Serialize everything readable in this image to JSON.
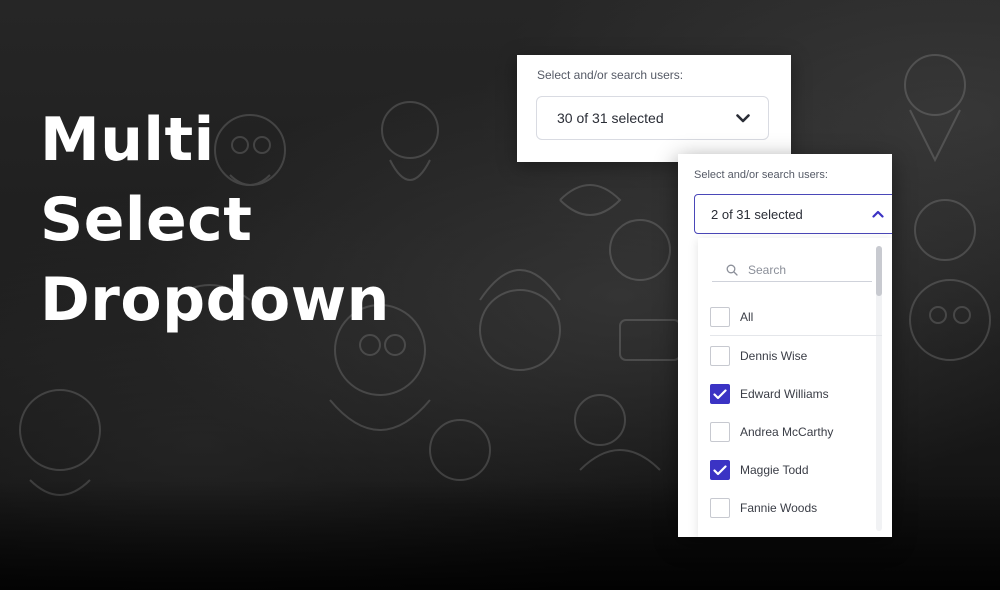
{
  "headline": {
    "line1": "Multi",
    "line2": "Select",
    "line3": "Dropdown"
  },
  "dropdown_closed": {
    "label": "Select and/or search users:",
    "value": "30 of 31 selected",
    "icon": "chevron-down-icon"
  },
  "dropdown_open": {
    "label": "Select and/or search users:",
    "value": "2 of 31 selected",
    "icon": "chevron-up-icon",
    "search_placeholder": "Search",
    "options": [
      {
        "label": "All",
        "checked": false
      },
      {
        "label": "Dennis Wise",
        "checked": false
      },
      {
        "label": "Edward Williams",
        "checked": true
      },
      {
        "label": "Andrea McCarthy",
        "checked": false
      },
      {
        "label": "Maggie Todd",
        "checked": true
      },
      {
        "label": "Fannie Woods",
        "checked": false
      }
    ]
  },
  "colors": {
    "accent": "#3b33c4",
    "focus_border": "#4a47b8",
    "background": "#1b1b1b",
    "headline": "#ffffff"
  }
}
